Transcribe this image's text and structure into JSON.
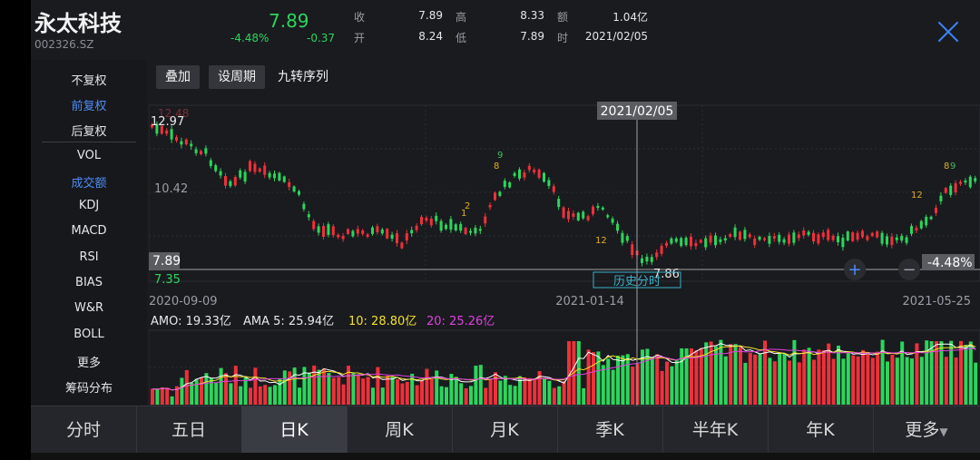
{
  "stock": {
    "name": "永太科技",
    "code": "002326.SZ",
    "price": "7.89",
    "change_pct": "-4.48%",
    "change": "-0.37"
  },
  "quote": {
    "close_label": "收",
    "close_value": "7.89",
    "open_label": "开",
    "open_value": "8.24",
    "high_label": "高",
    "high_value": "8.33",
    "low_label": "低",
    "low_value": "7.89",
    "amount_label": "额",
    "amount_value": "1.04亿",
    "time_label": "时",
    "time_value": "2021/02/05"
  },
  "sidebar": {
    "items": [
      "不复权",
      "前复权",
      "后复权",
      "VOL",
      "成交额",
      "KDJ",
      "MACD",
      "RSI",
      "BIAS",
      "W&R",
      "BOLL",
      "更多",
      "筹码分布"
    ]
  },
  "toolbar": {
    "overlay": "叠加",
    "period": "设周期",
    "nine_turn": "九转序列"
  },
  "chart": {
    "price_high_label": "12.97",
    "price_high_faded": "12.48",
    "price_mid_label": "10.42",
    "price_low_label": "7.89",
    "price_bottom_label": "7.35",
    "cursor_low_label": "7.86",
    "cursor_date": "2021/02/05",
    "right_pct": "-4.48%",
    "history_btn": "历史分时",
    "dates": [
      "2020-09-09",
      "2021-01-14",
      "2021-05-25"
    ],
    "zoom_in": "+",
    "zoom_out": "−",
    "nine_marks": [
      "9",
      "8",
      "2",
      "1",
      "12",
      "12",
      "8",
      "9"
    ]
  },
  "amount": {
    "amo_label": "AMO: 19.33亿",
    "ama5_label": "AMA 5: 25.94亿",
    "ama10_label": "10: 28.80亿",
    "ama20_label": "20: 25.26亿"
  },
  "colors": {
    "up": "#f0303a",
    "down": "#2bd65c",
    "ama5": "#ffffff",
    "ama10": "#f2e12a",
    "ama20": "#e040e0",
    "accent": "#3b82f6"
  },
  "tabs": [
    "分时",
    "五日",
    "日K",
    "周K",
    "月K",
    "季K",
    "半年K",
    "年K",
    "更多"
  ],
  "active_tab": "日K"
}
